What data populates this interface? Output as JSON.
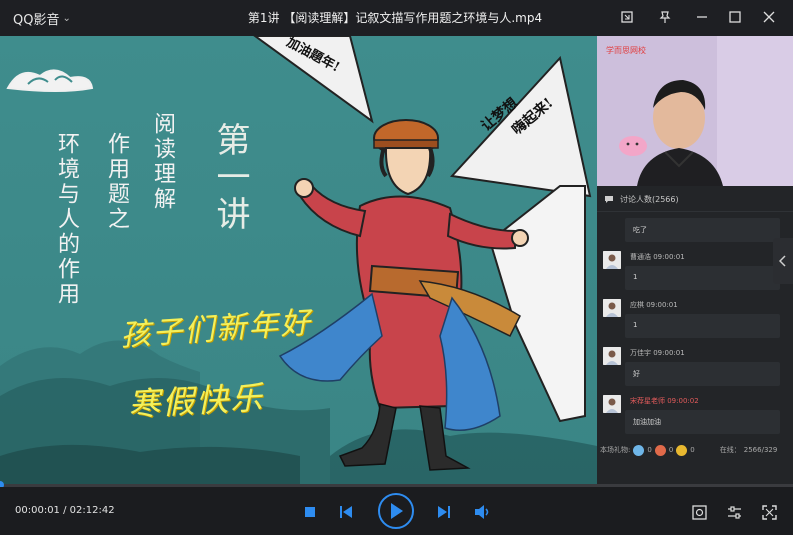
{
  "app": {
    "brand": "QQ影音",
    "title": "第1讲 【阅读理解】记叙文描写作用题之环境与人.mp4"
  },
  "video_overlay": {
    "vertical_lines": [
      "环境与人的作用",
      "作用题之",
      "阅读理解",
      "第一讲"
    ],
    "handwriting": [
      "孩子们新年好",
      "寒假快乐"
    ],
    "flags": [
      "加油題年!",
      "让梦想",
      "嗨起来!"
    ]
  },
  "side_panel": {
    "cam_logo": "学而思网校",
    "chat_header": "讨论人数(2566)",
    "messages": [
      {
        "name": "",
        "text": "吃了"
      },
      {
        "name": "曹通浩  09:00:01",
        "text": "1"
      },
      {
        "name": "应棋  09:00:01",
        "text": "1"
      },
      {
        "name": "万佳宇  09:00:01",
        "text": "好"
      },
      {
        "name": "宋荐星老师  09:00:02",
        "text": "加油加油",
        "teacher": true
      }
    ],
    "gifts_label": "本场礼物:",
    "gift_counts": [
      "0",
      "0",
      "0"
    ],
    "online_label": "在线：",
    "online_value": "2566/329"
  },
  "player": {
    "time": "00:00:01 / 02:12:42",
    "progress": 0.0001
  },
  "colors": {
    "accent": "#2e8cf0",
    "video_bg": "#3f8c8c",
    "chrome": "#1b1c1f"
  }
}
